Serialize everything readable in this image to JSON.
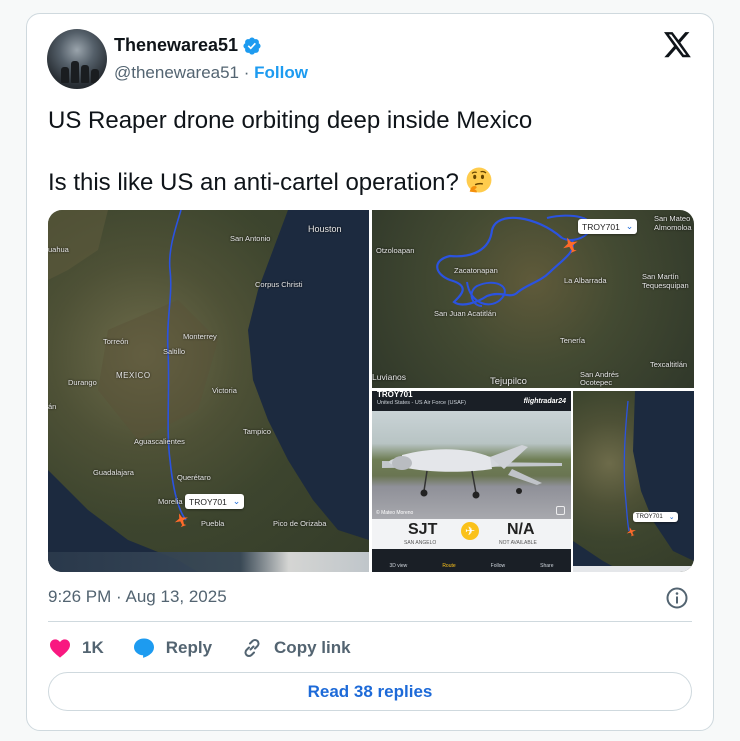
{
  "author": {
    "display_name": "Thenewarea51",
    "handle": "@thenewarea51",
    "separator": "·",
    "follow_label": "Follow"
  },
  "tweet": {
    "line1": "US Reaper drone orbiting deep inside Mexico",
    "line2": "Is this like US an anti-cartel operation?",
    "emoji": "thinking-face-icon"
  },
  "media": {
    "map_main": {
      "labels": [
        "Houston",
        "San Antonio",
        "Corpus Christi",
        "Monterrey",
        "Saltillo",
        "Torreón",
        "MEXICO",
        "Durango",
        "Victoria",
        "Tampico",
        "Aguascalientes",
        "Guadalajara",
        "Querétaro",
        "Morelia",
        "Puebla",
        "Pico de Orizaba",
        "uahua",
        "án"
      ],
      "flight": "TROY701"
    },
    "map_zoom": {
      "labels": [
        "Otzoloapan",
        "Zacatonapan",
        "San Juan Acatitlán",
        "La Albarrada",
        "San Martín Tequesquipan",
        "San Mateo Almomoloa",
        "Tenería",
        "Texcaltitlán",
        "Luvianos",
        "Tejupilco",
        "San Andrés Ocotepec"
      ],
      "flight": "TROY701"
    },
    "app": {
      "callsign": "TROY701",
      "operator": "United States - US Air Force (USAF)",
      "brand": "flightradar24",
      "photo_credit": "© Mateo Moreno",
      "origin_code": "SJT",
      "origin_name": "SAN ANGELO",
      "dest_code": "N/A",
      "dest_name": "NOT AVAILABLE",
      "tabs": [
        "3D view",
        "Route",
        "Follow",
        "Share"
      ]
    },
    "map_small": {
      "flight": "TROY701"
    }
  },
  "meta": {
    "time": "9:26 PM",
    "separator": "·",
    "date": "Aug 13, 2025"
  },
  "actions": {
    "likes": "1K",
    "reply_label": "Reply",
    "copy_label": "Copy link"
  },
  "replies_button": "Read 38 replies",
  "colors": {
    "accent": "#1d9bf0",
    "link_blue": "#1d6ad8",
    "like_red": "#f91880",
    "text_secondary": "#536471"
  }
}
